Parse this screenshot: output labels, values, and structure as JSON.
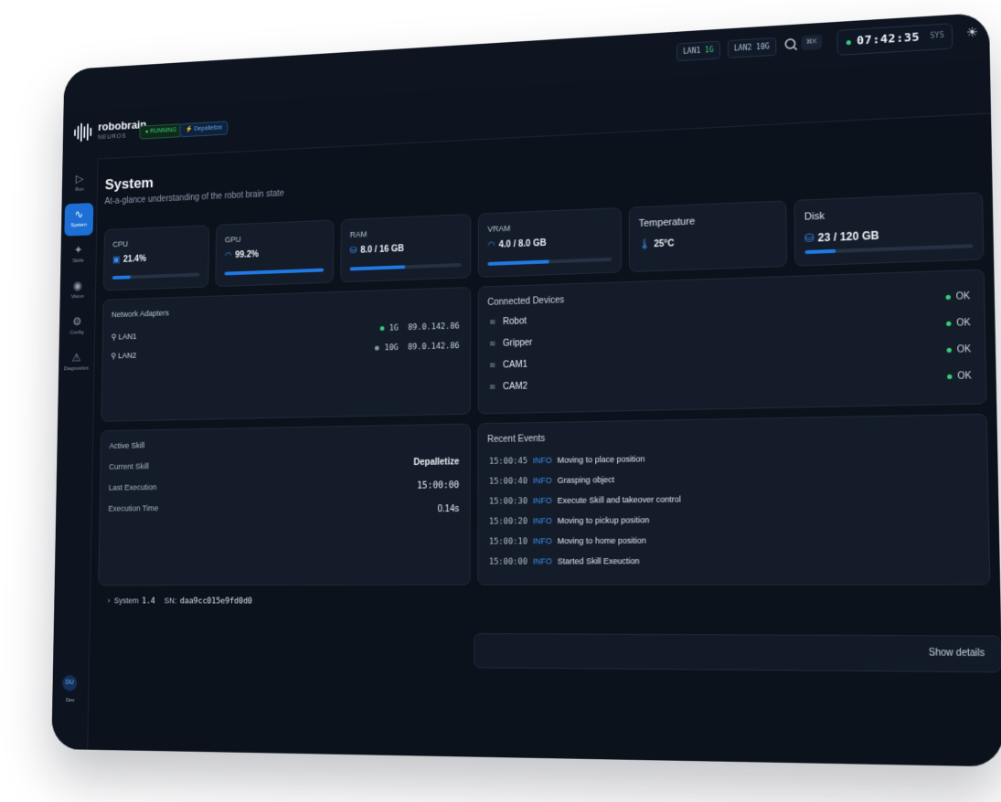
{
  "brand": {
    "name": "robobrain",
    "sub": "NEUROS"
  },
  "status": {
    "running": "● RUNNING",
    "skill": "⚡ Depalletize"
  },
  "topbar": {
    "lan1_label": "LAN1",
    "lan1_speed": "1G",
    "lan2": "LAN2 10G",
    "shortcut": "⌘K",
    "clock": "07:42:35",
    "clock_tag": "SYS"
  },
  "nav": [
    {
      "label": "Run",
      "icon": "play-icon"
    },
    {
      "label": "System",
      "icon": "pulse-icon",
      "active": true
    },
    {
      "label": "Skills",
      "icon": "sparkle-icon"
    },
    {
      "label": "Vision",
      "icon": "eye-icon"
    },
    {
      "label": "Config",
      "icon": "gear-icon"
    },
    {
      "label": "Diagnostics",
      "icon": "warning-icon"
    }
  ],
  "user": {
    "initials": "DU",
    "name": "Dev"
  },
  "page": {
    "title": "System",
    "subtitle": "At-a-glance understanding of the robot brain state"
  },
  "metrics": [
    {
      "label": "CPU",
      "value": "21.4%",
      "fill": 0.21
    },
    {
      "label": "GPU",
      "value": "99.2%",
      "fill": 0.99
    },
    {
      "label": "RAM",
      "value": "8.0 / 16 GB",
      "fill": 0.5
    },
    {
      "label": "VRAM",
      "value": "4.0 / 8.0 GB",
      "fill": 0.5
    },
    {
      "label": "Temperature",
      "value": "25°C"
    },
    {
      "label": "Disk",
      "value": "23 / 120 GB",
      "fill": 0.19
    }
  ],
  "network": {
    "title": "Network Adapters",
    "adapters": [
      {
        "name": "LAN1",
        "speed": "1G",
        "ip": "89.0.142.86",
        "up": true
      },
      {
        "name": "LAN2",
        "speed": "10G",
        "ip": "89.0.142.86",
        "up": false
      }
    ]
  },
  "devices": {
    "title": "Connected Devices",
    "items": [
      {
        "name": "Robot",
        "status": "OK"
      },
      {
        "name": "Gripper",
        "status": "OK"
      },
      {
        "name": "CAM1",
        "status": "OK"
      },
      {
        "name": "CAM2",
        "status": "OK"
      }
    ]
  },
  "active_skill": {
    "title": "Active Skill",
    "rows": [
      {
        "label": "Current Skill",
        "value": "Depalletize"
      },
      {
        "label": "Last Execution",
        "value": "15:00:00"
      },
      {
        "label": "Execution Time",
        "value": "0.14s"
      }
    ]
  },
  "events": {
    "title": "Recent Events",
    "items": [
      {
        "time": "15:00:45",
        "level": "INFO",
        "msg": "Moving to place position"
      },
      {
        "time": "15:00:40",
        "level": "INFO",
        "msg": "Grasping object"
      },
      {
        "time": "15:00:30",
        "level": "INFO",
        "msg": "Execute Skill and takeover control"
      },
      {
        "time": "15:00:20",
        "level": "INFO",
        "msg": "Moving to pickup position"
      },
      {
        "time": "15:00:10",
        "level": "INFO",
        "msg": "Moving to home position"
      },
      {
        "time": "15:00:00",
        "level": "INFO",
        "msg": "Started Skill Exeuction"
      }
    ]
  },
  "footer": {
    "label": "System",
    "version": "1.4",
    "sn_label": "SN:",
    "sn": "daa9cc015e9fd0d0"
  },
  "show_details": "Show details"
}
